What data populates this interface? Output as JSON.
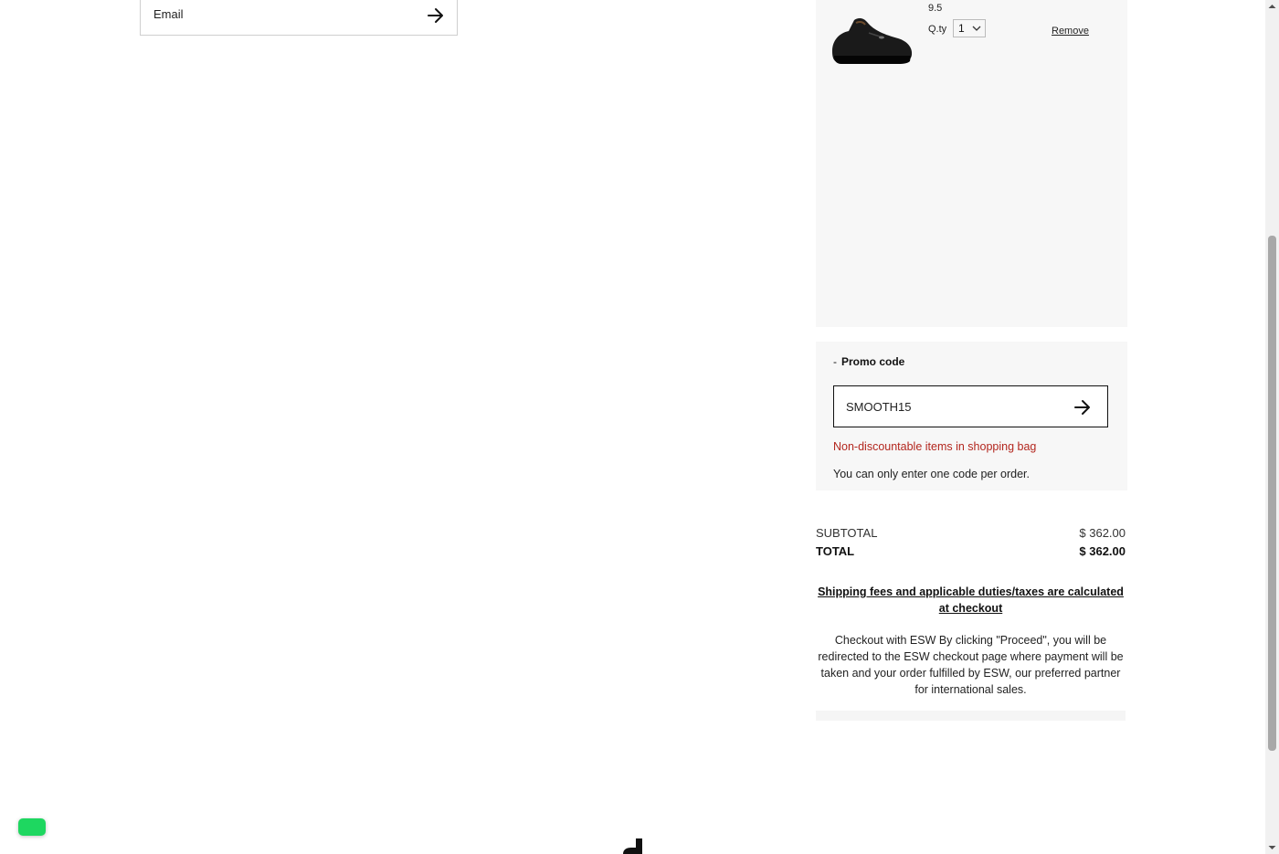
{
  "newsletter": {
    "email_label": "Email"
  },
  "cart": {
    "item": {
      "size": "9.5",
      "qty_label": "Q.ty",
      "qty_value": "1",
      "remove_label": "Remove"
    }
  },
  "promo": {
    "toggle_symbol": "-",
    "title": "Promo code",
    "code_value": "SMOOTH15",
    "error": "Non-discountable items in shopping bag",
    "note": "You can only enter one code per order."
  },
  "summary": {
    "subtotal_label": "SUBTOTAL",
    "subtotal_value": "$ 362.00",
    "total_label": "TOTAL",
    "total_value": "$ 362.00",
    "shipping_note": "Shipping fees and applicable duties/taxes are calculated at checkout",
    "checkout_note": "Checkout with ESW By clicking \"Proceed\", you will be redirected to the ESW checkout page where payment will be taken and your order fulfilled by ESW, our preferred partner for international sales."
  },
  "colors": {
    "error": "#b3261e",
    "panel_bg": "#f7f7f7",
    "chat_button": "#1ed760"
  },
  "icons": {
    "email_submit": "arrow-right-icon",
    "promo_submit": "arrow-right-icon",
    "qty": "chevron-down-icon",
    "chat": "chat-icon",
    "footer_logo": "brand-logo-icon"
  }
}
